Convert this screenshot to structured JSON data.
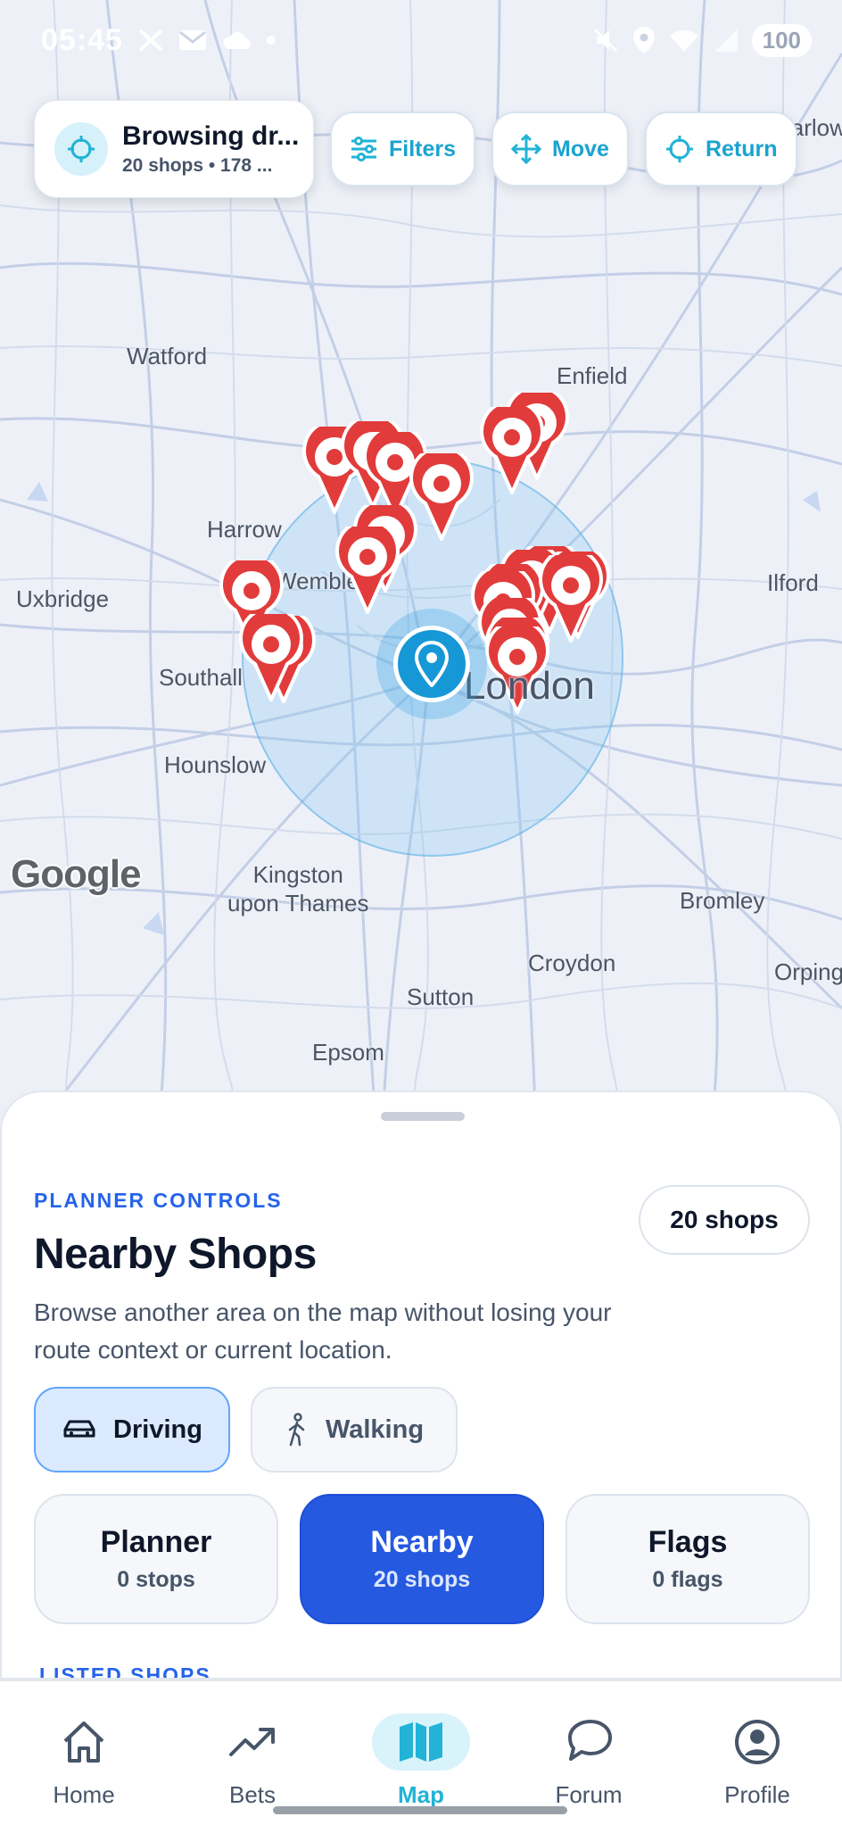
{
  "status_bar": {
    "time": "05:45",
    "battery": "100"
  },
  "browse_card": {
    "title": "Browsing dr...",
    "subtitle": "20 shops • 178 ..."
  },
  "top_chips": {
    "filters": "Filters",
    "move": "Move",
    "return": "Return"
  },
  "map": {
    "places": {
      "watford": "Watford",
      "enfield": "Enfield",
      "harrow": "Harrow",
      "wembley": "Wembley",
      "uxbridge": "Uxbridge",
      "ilford": "Ilford",
      "southall": "Southall",
      "london": "London",
      "hounslow": "Hounslow",
      "kingston": "Kingston\nupon Thames",
      "bromley": "Bromley",
      "croydon": "Croydon",
      "orpington": "Orping",
      "sutton": "Sutton",
      "epsom": "Epsom",
      "harlow": "Harlow"
    },
    "attribution": "Google",
    "pin_color": "#e23b3b",
    "radius_color": "#7dc4f0"
  },
  "sheet": {
    "eyebrow": "PLANNER CONTROLS",
    "title": "Nearby Shops",
    "description": "Browse another area on the map without losing your route context or current location.",
    "count_badge": "20 shops",
    "modes": [
      {
        "label": "Driving",
        "icon": "car-icon",
        "active": true
      },
      {
        "label": "Walking",
        "icon": "walking-icon",
        "active": false
      }
    ],
    "tabs": [
      {
        "title": "Planner",
        "sub": "0 stops",
        "active": false
      },
      {
        "title": "Nearby",
        "sub": "20 shops",
        "active": true
      },
      {
        "title": "Flags",
        "sub": "0 flags",
        "active": false
      }
    ],
    "listed_heading": "LISTED SHOPS"
  },
  "nav": {
    "items": [
      {
        "label": "Home",
        "icon": "home-icon"
      },
      {
        "label": "Bets",
        "icon": "trending-icon"
      },
      {
        "label": "Map",
        "icon": "map-icon",
        "active": true
      },
      {
        "label": "Forum",
        "icon": "chat-icon"
      },
      {
        "label": "Profile",
        "icon": "profile-icon"
      }
    ]
  },
  "colors": {
    "accent": "#2559e0",
    "teal": "#22b3d6",
    "pin": "#e23b3b"
  }
}
